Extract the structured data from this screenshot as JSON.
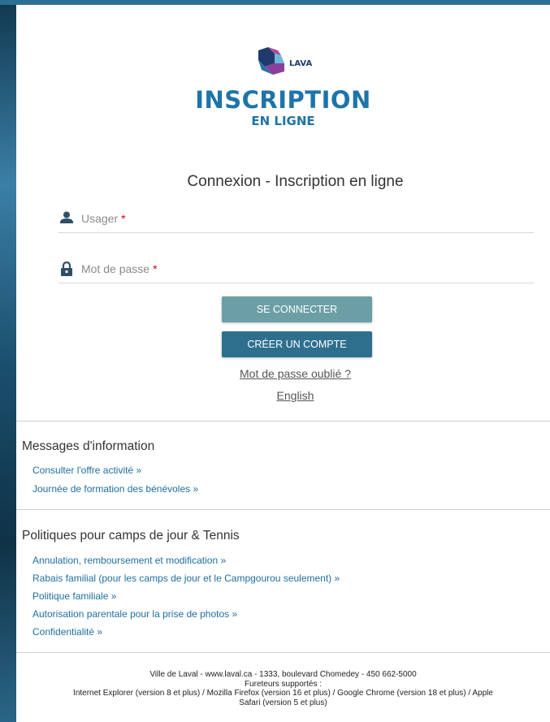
{
  "logo": {
    "brand": "LAVAL",
    "title": "INSCRIPTION",
    "subtitle": "EN LIGNE"
  },
  "heading": "Connexion - Inscription en ligne",
  "form": {
    "username_label": "Usager",
    "password_label": "Mot de passe",
    "required_mark": "*",
    "login_button": "SE CONNECTER",
    "create_button": "CRÉER UN COMPTE",
    "forgot_link": "Mot de passe oublié ?",
    "language_link": "English"
  },
  "info": {
    "title": "Messages d'information",
    "links": [
      "Consulter l'offre activité »",
      "Journée de formation des bénévoles »"
    ]
  },
  "policies": {
    "title": "Politiques pour camps de jour & Tennis",
    "links": [
      "Annulation, remboursement et modification »",
      "Rabais familial (pour les camps de jour et le Campgourou seulement) »",
      "Politique familiale »",
      "Autorisation parentale pour la prise de photos »",
      "Confidentialité »"
    ]
  },
  "footer": {
    "line1": "Ville de Laval - www.laval.ca - 1333, boulevard Chomedey - 450 662-5000",
    "line2": "Fureteurs supportés :",
    "line3": "Internet Explorer (version 8 et plus) / Mozilla Firefox (version 16 et plus) / Google Chrome (version 18 et plus) / Apple",
    "line4": "Safari (version 5 et plus)"
  },
  "colors": {
    "accent": "#1e74a8",
    "login_button": "#6b9fa5",
    "create_button": "#2f6f8e",
    "required": "#d0021b"
  }
}
